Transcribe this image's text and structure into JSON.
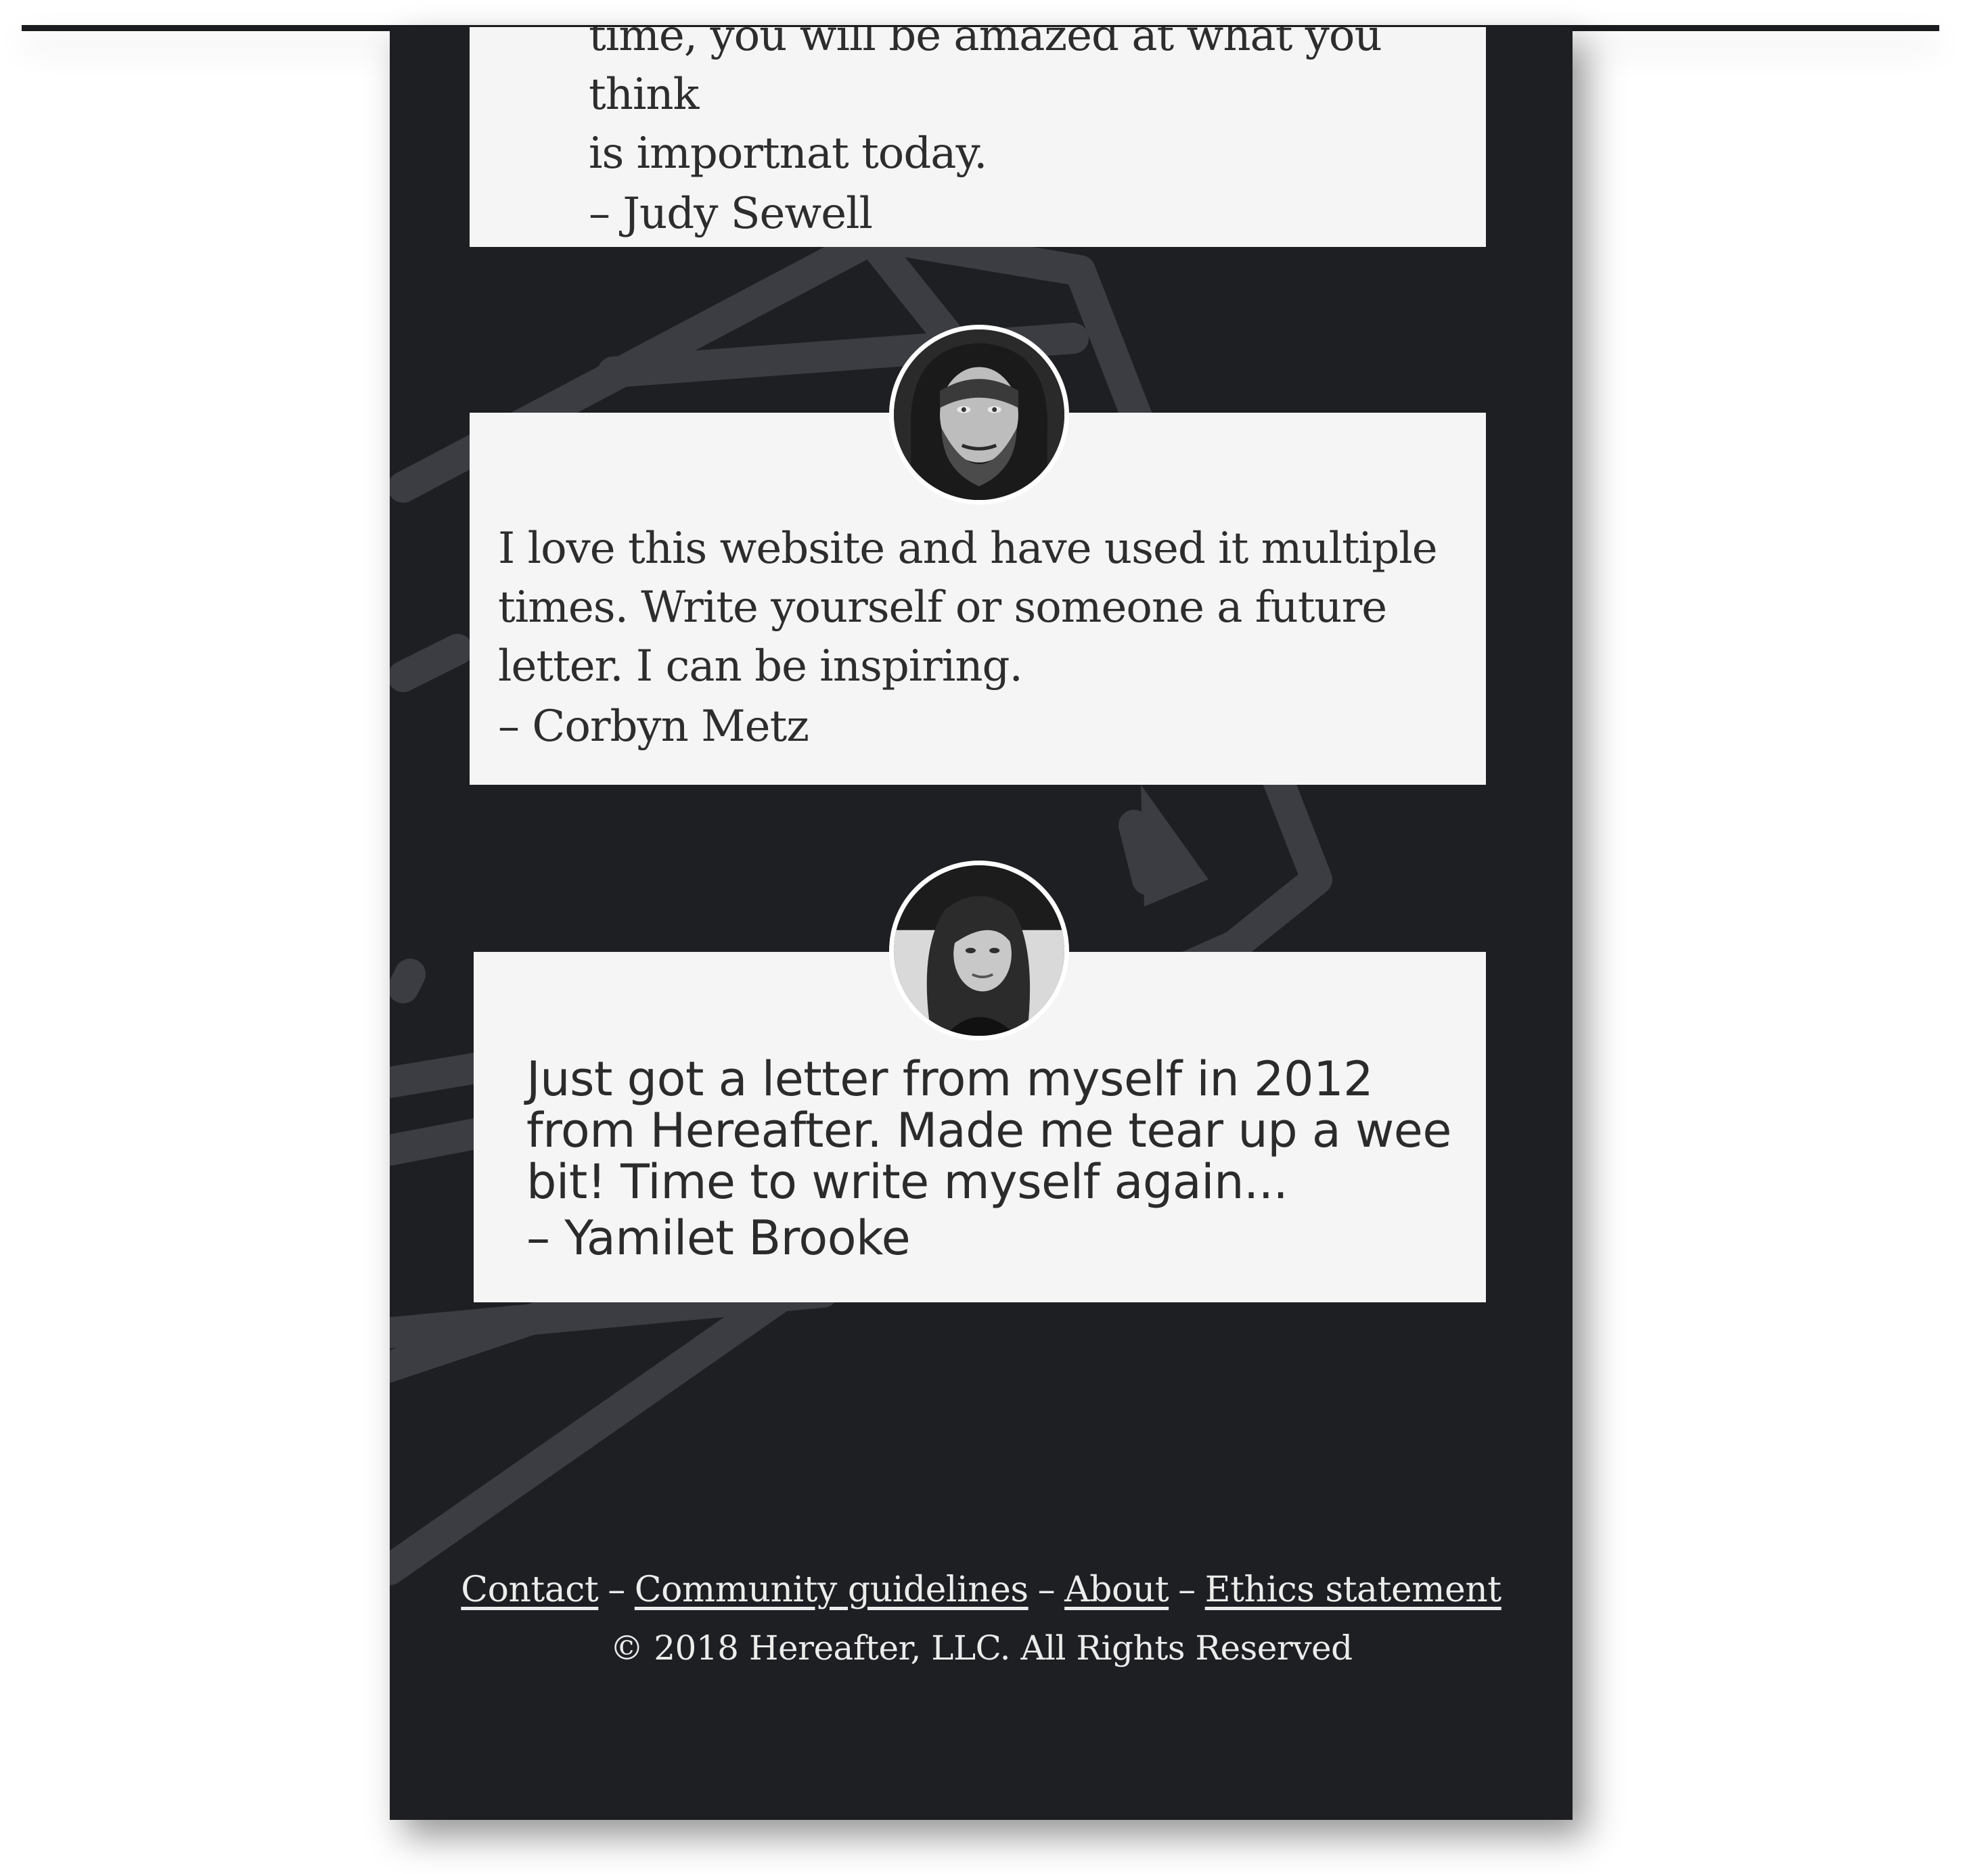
{
  "testimonials": [
    {
      "quote_lines": [
        "time, you will be amazed at what you think",
        "is importnat today."
      ],
      "author": "– Judy Sewell"
    },
    {
      "quote_lines": [
        "I love this website and have used it multiple",
        "times. Write yourself or someone a future",
        "letter. I can be inspiring."
      ],
      "author": "– Corbyn Metz"
    },
    {
      "quote_lines": [
        "Just got a letter from myself in 2012",
        "from Hereafter. Made me tear up a wee",
        "bit! Time to write myself again..."
      ],
      "author": "– Yamilet Brooke"
    }
  ],
  "footer": {
    "links": [
      "Contact",
      "Community guidelines",
      "About",
      "Ethics statement"
    ],
    "separator": "–",
    "copyright": "© 2018 Hereafter, LLC. All Rights Reserved"
  },
  "colors": {
    "page_background": "#1e1f23",
    "card_background": "#f5f5f5",
    "card_text": "#2d2d2d",
    "footer_text": "#ececec",
    "decor_stroke": "#3b3d42"
  }
}
